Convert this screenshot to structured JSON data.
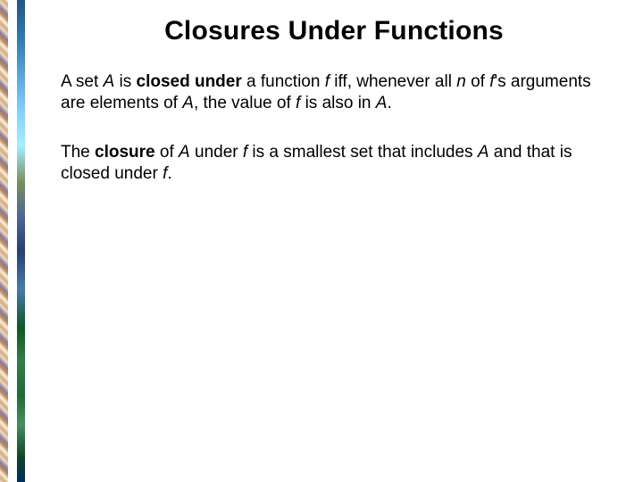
{
  "slide": {
    "title": "Closures Under Functions",
    "p1": {
      "t1": "A set ",
      "v1": "A",
      "t2": " is ",
      "b1": "closed under",
      "t3": " a function ",
      "v2": "f",
      "t4": " iff, whenever all ",
      "v3": "n",
      "t5": " of ",
      "v4": "f",
      "t6": "'s arguments are elements of ",
      "v5": "A",
      "t7": ", the value of ",
      "v6": "f",
      "t8": " is also in ",
      "v7": "A",
      "t9": "."
    },
    "p2": {
      "t1": "The ",
      "b1": "closure",
      "t2": " of ",
      "v1": "A",
      "t3": " under ",
      "v2": "f",
      "t4": " is a smallest set that includes ",
      "v3": "A",
      "t5": " and that is closed under ",
      "v4": "f",
      "t6": "."
    }
  }
}
